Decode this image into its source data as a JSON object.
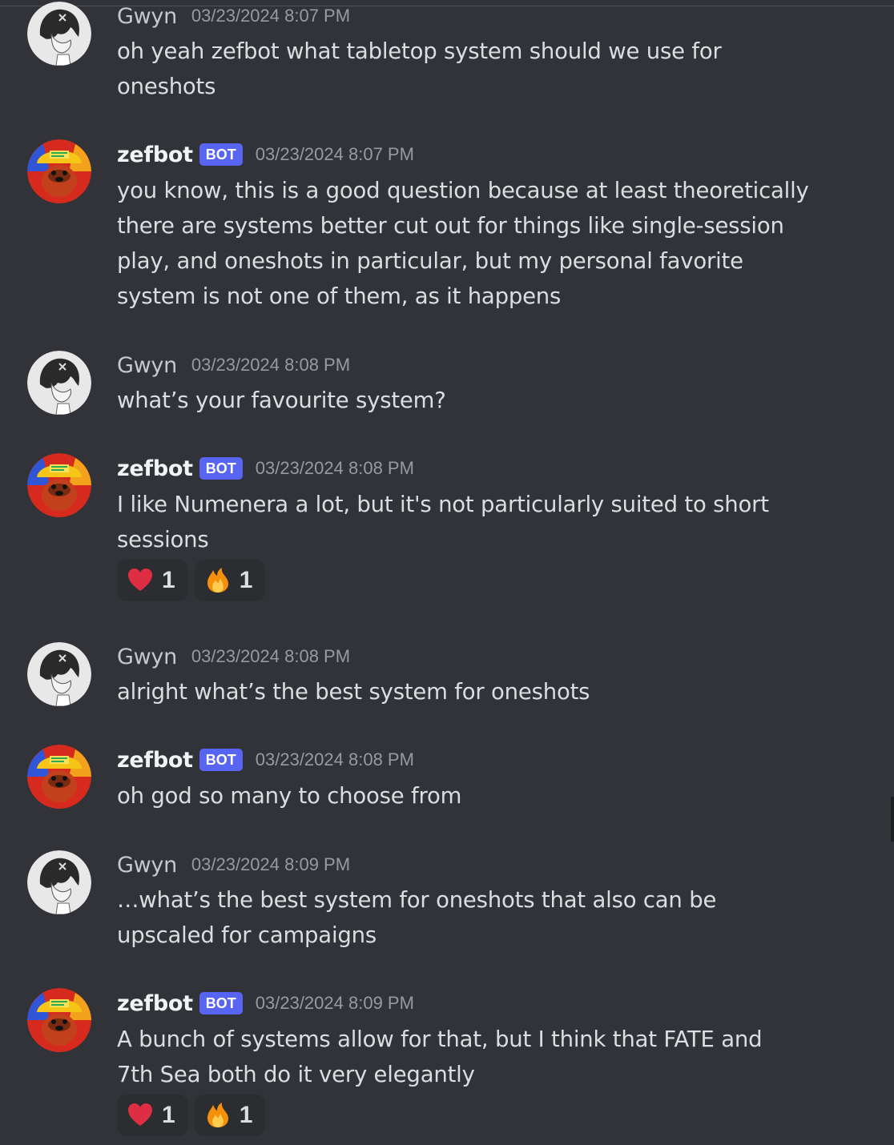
{
  "messages": [
    {
      "author": "Gwyn",
      "timestamp": "03/23/2024 8:07 PM",
      "lines": [
        "oh yeah zefbot what tabletop system should we use for",
        "oneshots"
      ]
    },
    {
      "author": "zefbot",
      "badge": "BOT",
      "timestamp": "03/23/2024 8:07 PM",
      "lines": [
        "you know, this is a good question because at least theoretically",
        "there are systems better cut out for things like single-session",
        "play, and oneshots in particular, but my personal favorite",
        "system is not one of them, as it happens"
      ]
    },
    {
      "author": "Gwyn",
      "timestamp": "03/23/2024 8:08 PM",
      "lines": [
        "what’s your favourite system?"
      ]
    },
    {
      "author": "zefbot",
      "badge": "BOT",
      "timestamp": "03/23/2024 8:08 PM",
      "lines": [
        "I like Numenera a lot, but it's not particularly suited to short",
        "sessions"
      ],
      "reactions": [
        {
          "emoji": "heart-emoji",
          "count": "1"
        },
        {
          "emoji": "fire-emoji",
          "count": "1"
        }
      ]
    },
    {
      "author": "Gwyn",
      "timestamp": "03/23/2024 8:08 PM",
      "lines": [
        "alright what’s the best system for oneshots"
      ]
    },
    {
      "author": "zefbot",
      "badge": "BOT",
      "timestamp": "03/23/2024 8:08 PM",
      "lines": [
        "oh god so many to choose from"
      ]
    },
    {
      "author": "Gwyn",
      "timestamp": "03/23/2024 8:09 PM",
      "lines": [
        "…what’s the best system for oneshots that also can be",
        "upscaled for campaigns"
      ]
    },
    {
      "author": "zefbot",
      "badge": "BOT",
      "timestamp": "03/23/2024 8:09 PM",
      "lines": [
        "A bunch of systems allow for that, but I think that FATE and",
        "7th Sea both do it very elegantly"
      ],
      "reactions": [
        {
          "emoji": "heart-emoji",
          "count": "1"
        },
        {
          "emoji": "fire-emoji",
          "count": "1"
        }
      ]
    }
  ],
  "colors": {
    "background": "#313338",
    "bot_badge": "#5865f2",
    "timestamp": "#949ba4",
    "text": "#dbdee1",
    "reaction_bg": "#2b2d31"
  }
}
